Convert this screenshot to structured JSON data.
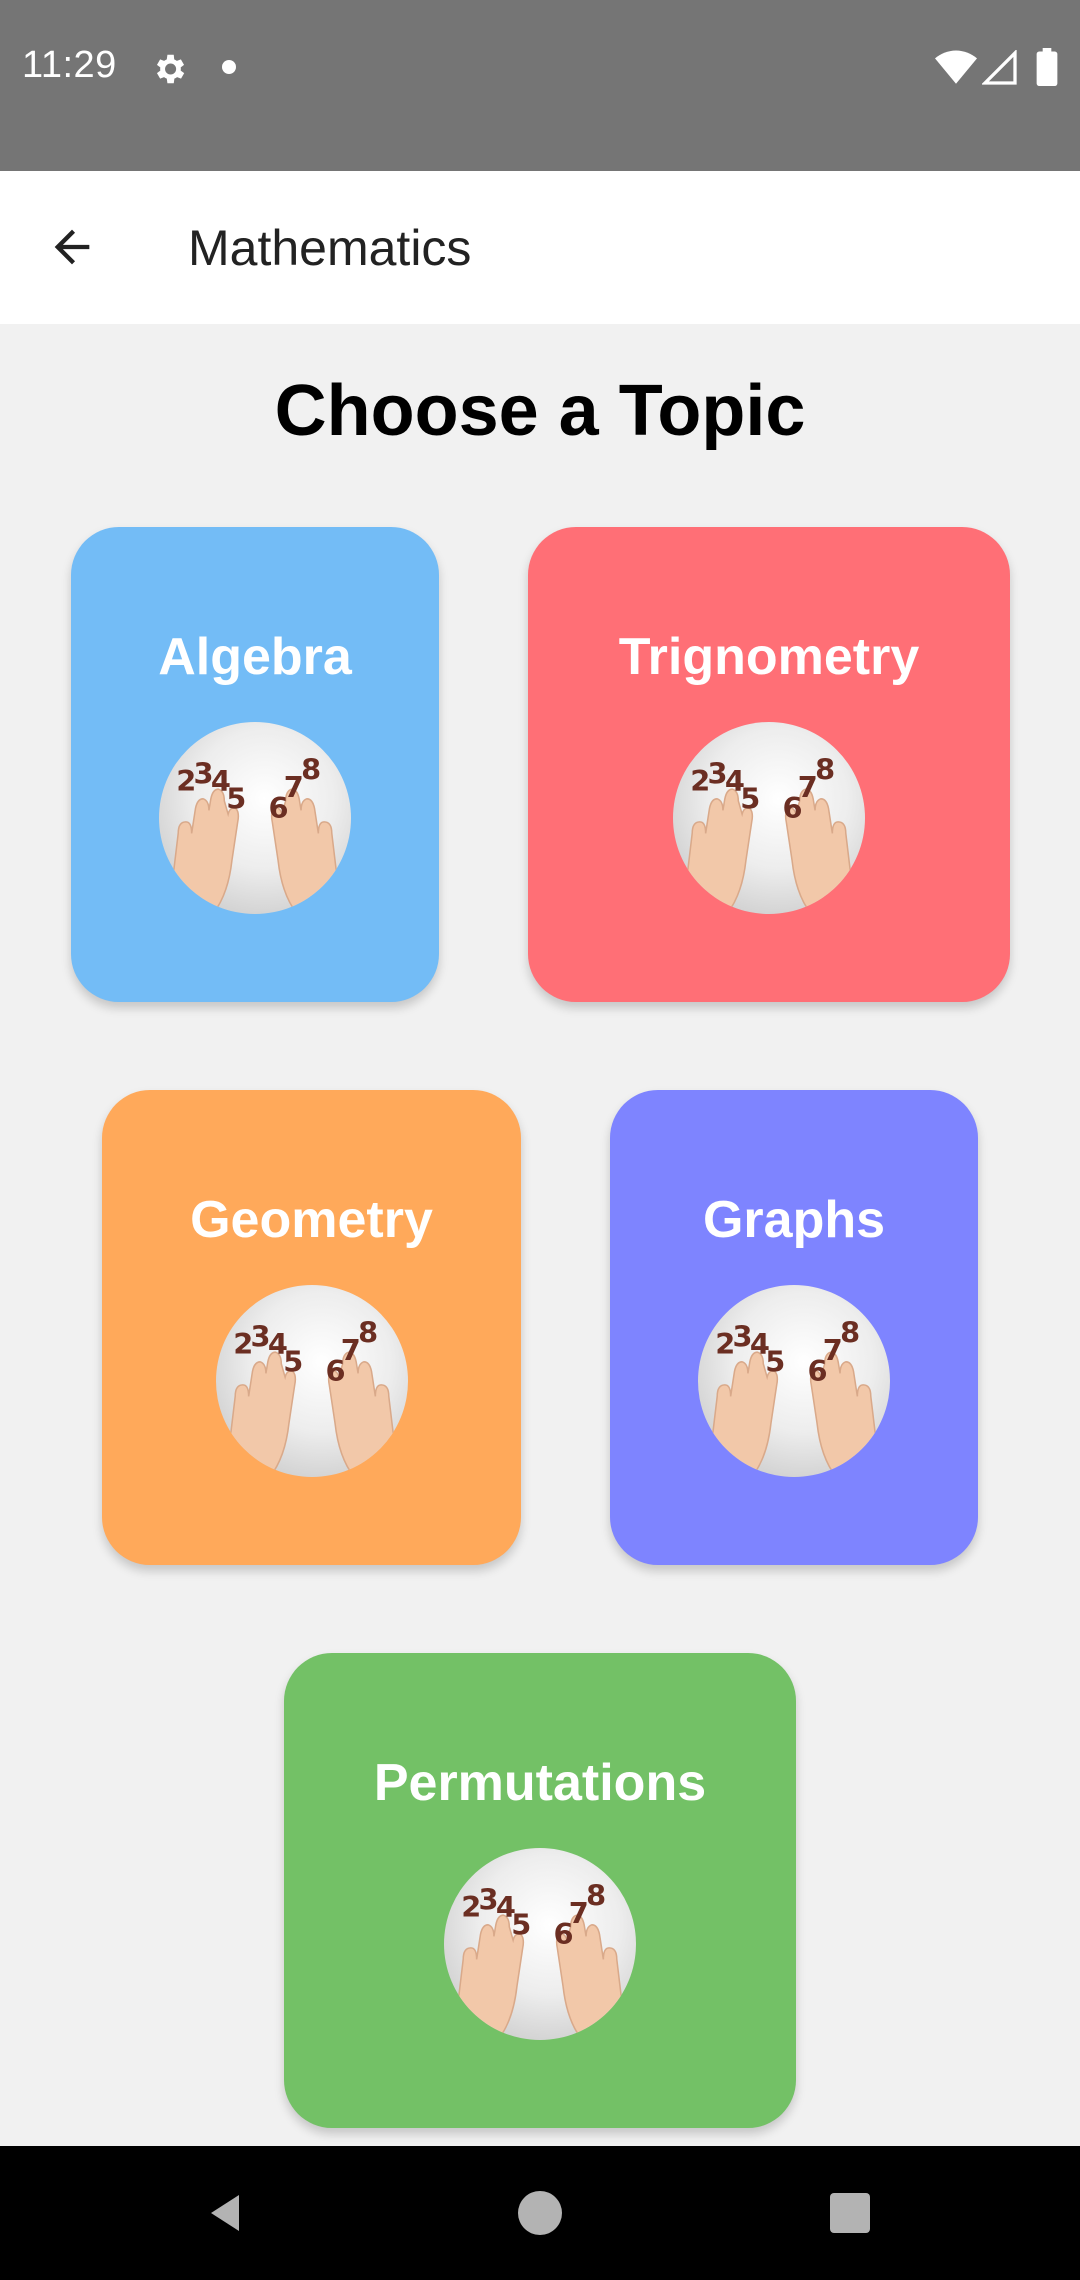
{
  "status_bar": {
    "time": "11:29",
    "icons": [
      "gear-icon",
      "notification-dot-icon",
      "wifi-icon",
      "signal-icon",
      "battery-icon"
    ]
  },
  "app_bar": {
    "title": "Mathematics",
    "back_icon": "arrow-left-icon"
  },
  "heading": "Choose a Topic",
  "topics": [
    {
      "label": "Algebra",
      "color": "#73bcf6",
      "image": "counting-hands-image"
    },
    {
      "label": "Trignometry",
      "color": "#ff6f76",
      "image": "counting-hands-image"
    },
    {
      "label": "Geometry",
      "color": "#ffa95a",
      "image": "counting-hands-image"
    },
    {
      "label": "Graphs",
      "color": "#7e84ff",
      "image": "counting-hands-image"
    },
    {
      "label": "Permutations",
      "color": "#73c166",
      "image": "counting-hands-image"
    }
  ],
  "nav_bar": {
    "icons": [
      "nav-back-icon",
      "nav-home-icon",
      "nav-recents-icon"
    ]
  },
  "colors": {
    "status_bar": "#757575",
    "app_bar": "#ffffff",
    "background": "#f1f1f1",
    "nav_bar": "#000000"
  }
}
